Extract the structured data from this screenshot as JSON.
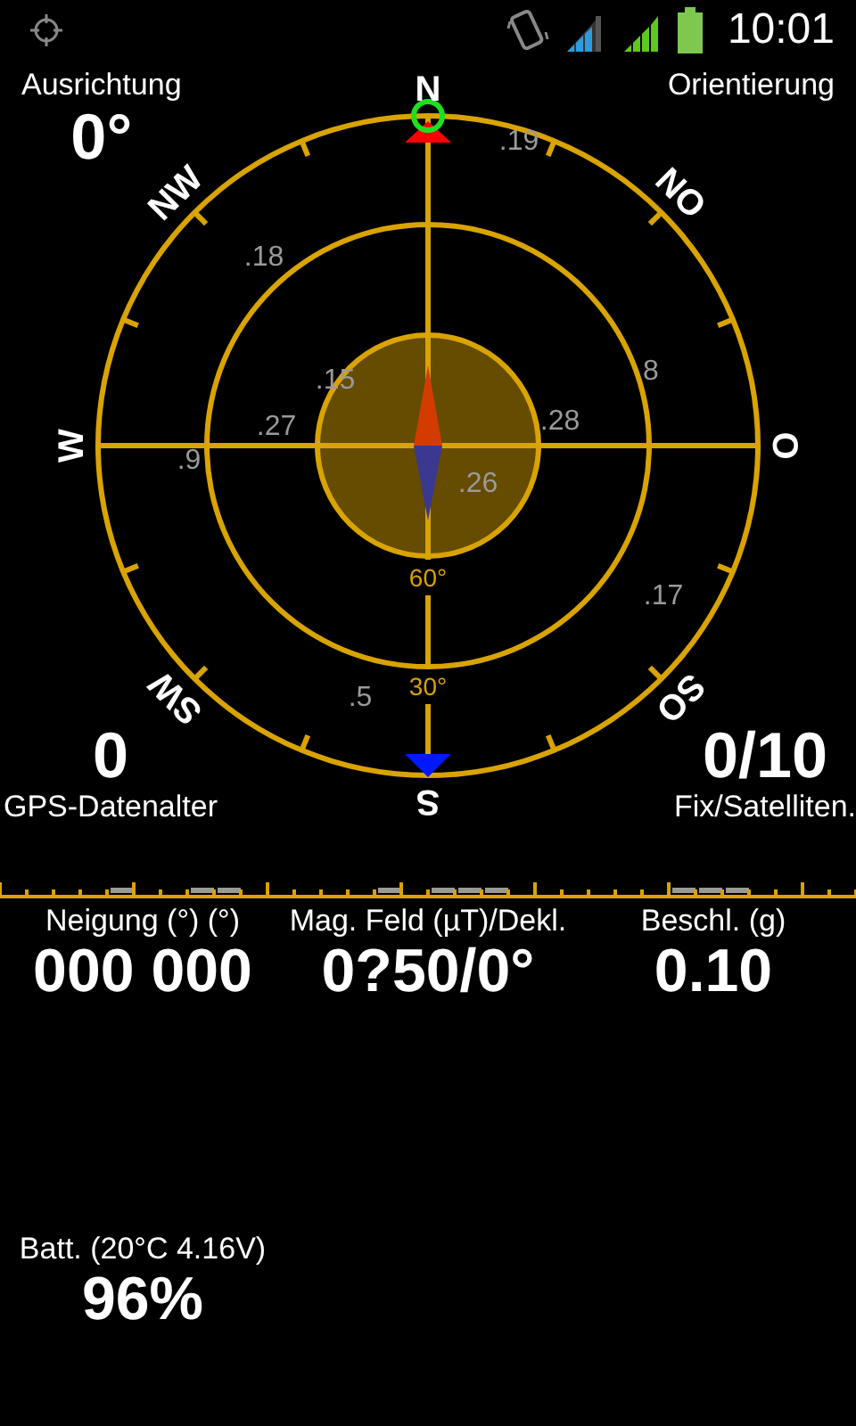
{
  "status_bar": {
    "time": "10:01"
  },
  "heading": {
    "label": "Ausrichtung",
    "value": "0°"
  },
  "orientation": {
    "label": "Orientierung"
  },
  "compass": {
    "directions": [
      "N",
      "NO",
      "O",
      "SO",
      "S",
      "SW",
      "W",
      "NW"
    ],
    "elevation_labels": [
      "60°",
      "30°"
    ],
    "satellites": [
      ".19",
      ".18",
      ".15",
      ".27",
      ".9",
      "8",
      ".28",
      ".26",
      ".17",
      ".5"
    ]
  },
  "gps_age": {
    "value": "0",
    "label": "GPS-Datenalter"
  },
  "fix": {
    "value": "0/10",
    "label": "Fix/Satelliten."
  },
  "readings": [
    {
      "label": "Neigung (°) (°)",
      "value": "000 000"
    },
    {
      "label": "Mag. Feld (µT)/Dekl.",
      "value": "0?50/0°"
    },
    {
      "label": "Beschl. (g)",
      "value": "0.10"
    }
  ],
  "battery": {
    "label": "Batt. (20°C 4.16V)",
    "value": "96%"
  }
}
